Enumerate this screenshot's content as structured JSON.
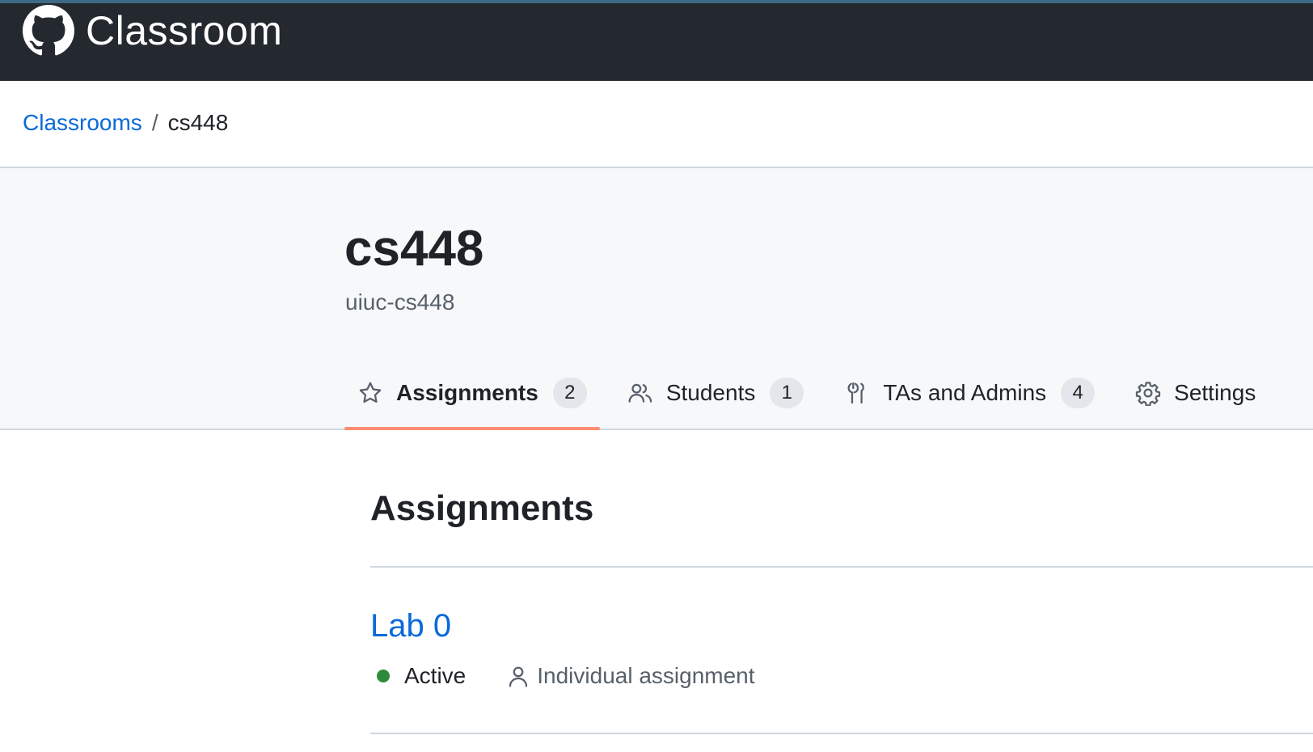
{
  "header": {
    "app_name": "Classroom",
    "logo_icon": "github-octocat-icon"
  },
  "breadcrumb": {
    "parent_label": "Classrooms",
    "separator": "/",
    "current_label": "cs448"
  },
  "classroom": {
    "title": "cs448",
    "subtitle": "uiuc-cs448"
  },
  "tabs": [
    {
      "label": "Assignments",
      "count": "2",
      "icon": "star-icon",
      "active": true
    },
    {
      "label": "Students",
      "count": "1",
      "icon": "people-icon",
      "active": false
    },
    {
      "label": "TAs and Admins",
      "count": "4",
      "icon": "tools-icon",
      "active": false
    },
    {
      "label": "Settings",
      "count": null,
      "icon": "gear-icon",
      "active": false
    }
  ],
  "assignments": {
    "section_title": "Assignments",
    "items": [
      {
        "title": "Lab 0",
        "status": "Active",
        "type": "Individual assignment",
        "status_color": "#2d8a3a"
      }
    ]
  },
  "colors": {
    "header_bg": "#24292f",
    "link": "#0969da",
    "active_tab_underline": "#fd8c73",
    "hero_bg": "#f6f8fa"
  }
}
